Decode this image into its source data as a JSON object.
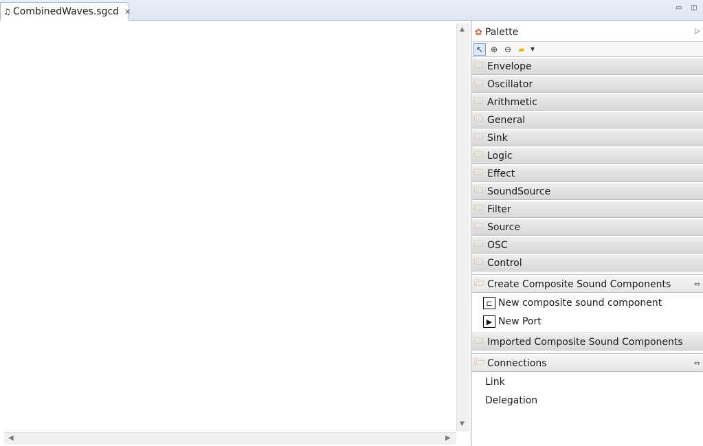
{
  "editor": {
    "tab_title": "CombinedWaves.sgcd",
    "tab_icon": "music-note-icon"
  },
  "palette": {
    "title": "Palette",
    "drawers": [
      {
        "label": "Envelope"
      },
      {
        "label": "Oscillator"
      },
      {
        "label": "Arithmetic"
      },
      {
        "label": "General"
      },
      {
        "label": "Sink"
      },
      {
        "label": "Logic"
      },
      {
        "label": "Effect"
      },
      {
        "label": "SoundSource"
      },
      {
        "label": "Filter"
      },
      {
        "label": "Source"
      },
      {
        "label": "OSC"
      },
      {
        "label": "Control"
      }
    ],
    "composite_section": {
      "label": "Create Composite Sound Components",
      "entries": [
        {
          "label": "New composite sound component"
        },
        {
          "label": "New Port"
        }
      ]
    },
    "imported_section": {
      "label": "Imported Composite Sound Components"
    },
    "connections_section": {
      "label": "Connections",
      "entries": [
        {
          "label": "Link"
        },
        {
          "label": "Delegation"
        }
      ]
    }
  },
  "colors": {
    "tabbar": "#dde6f2",
    "drawer": "#d8d8d8",
    "folder": "#c8912a"
  }
}
